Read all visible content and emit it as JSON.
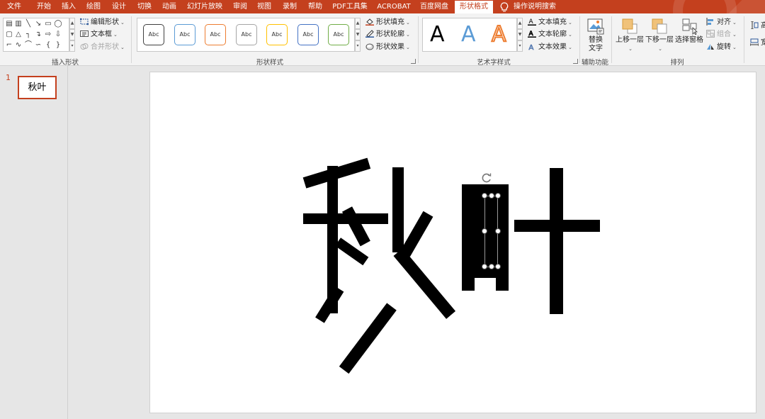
{
  "tabs": [
    "文件",
    "开始",
    "插入",
    "绘图",
    "设计",
    "切换",
    "动画",
    "幻灯片放映",
    "审阅",
    "视图",
    "录制",
    "帮助",
    "PDF工具集",
    "ACROBAT",
    "百度网盘",
    "形状格式",
    "操作说明搜索"
  ],
  "active_tab": "形状格式",
  "ribbon": {
    "insert_shapes": {
      "label": "插入形状",
      "edit_shape": "编辑形状",
      "text_box": "文本框",
      "merge_shapes": "合并形状"
    },
    "shape_styles": {
      "label": "形状样式",
      "preset_text": "Abc",
      "preset_colors": [
        "#404040",
        "#5b9bd5",
        "#ed7d31",
        "#a5a5a5",
        "#ffc000",
        "#4472c4",
        "#70ad47"
      ],
      "shape_fill": "形状填充",
      "shape_outline": "形状轮廓",
      "shape_effects": "形状效果"
    },
    "wordart_styles": {
      "label": "艺术字样式",
      "glyph": "A",
      "text_fill": "文本填充",
      "text_outline": "文本轮廓",
      "text_effects": "文本效果"
    },
    "accessibility": {
      "label": "辅助功能",
      "alt_text_line1": "替换",
      "alt_text_line2": "文字"
    },
    "arrange": {
      "label": "排列",
      "bring_forward": "上移一层",
      "send_backward": "下移一层",
      "selection_pane": "选择窗格",
      "align": "对齐",
      "group": "组合",
      "rotate": "旋转"
    },
    "size": {
      "height_cut": "高",
      "width_cut": "宽"
    }
  },
  "slides": {
    "number": "1",
    "thumb_text": "秋叶"
  },
  "slide_content": {
    "text": "秋叶"
  }
}
